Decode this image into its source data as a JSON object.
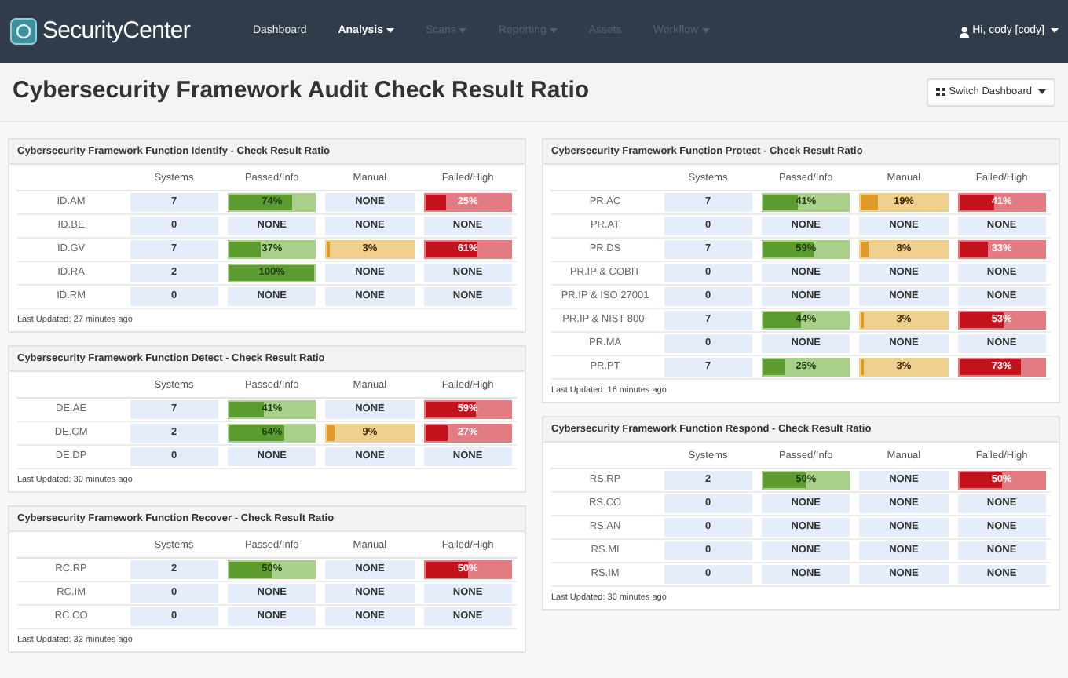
{
  "navbar": {
    "brand": "SecurityCenter",
    "items": [
      {
        "label": "Dashboard",
        "caret": false,
        "selected": false,
        "disabled": false
      },
      {
        "label": "Analysis",
        "caret": true,
        "selected": true,
        "disabled": false
      },
      {
        "label": "Scans",
        "caret": true,
        "selected": false,
        "disabled": true
      },
      {
        "label": "Reporting",
        "caret": true,
        "selected": false,
        "disabled": true
      },
      {
        "label": "Assets",
        "caret": false,
        "selected": false,
        "disabled": true
      },
      {
        "label": "Workflow",
        "caret": true,
        "selected": false,
        "disabled": true
      }
    ],
    "user": "Hi, cody [cody]"
  },
  "page_title": "Cybersecurity Framework Audit Check Result Ratio",
  "switch_button": "Switch Dashboard",
  "columns": [
    [
      {
        "title": "Cybersecurity Framework Function Identify - Check Result Ratio",
        "headers": [
          "Systems",
          "Passed/Info",
          "Manual",
          "Failed/High"
        ],
        "rows": [
          {
            "label": "ID.AM",
            "systems": "7",
            "passed": {
              "text": "74%",
              "level": 0.74
            },
            "manual": {
              "text": "NONE"
            },
            "failed": {
              "text": "25%",
              "level": 0.25
            }
          },
          {
            "label": "ID.BE",
            "systems": "0",
            "passed": {
              "text": "NONE"
            },
            "manual": {
              "text": "NONE"
            },
            "failed": {
              "text": "NONE"
            }
          },
          {
            "label": "ID.GV",
            "systems": "7",
            "passed": {
              "text": "37%",
              "level": 0.37
            },
            "manual": {
              "text": "3%",
              "level": 0.03
            },
            "failed": {
              "text": "61%",
              "level": 0.61
            }
          },
          {
            "label": "ID.RA",
            "systems": "2",
            "passed": {
              "text": "100%",
              "level": 1
            },
            "manual": {
              "text": "NONE"
            },
            "failed": {
              "text": "NONE"
            }
          },
          {
            "label": "ID.RM",
            "systems": "0",
            "passed": {
              "text": "NONE"
            },
            "manual": {
              "text": "NONE"
            },
            "failed": {
              "text": "NONE"
            }
          }
        ],
        "footer": "Last Updated: 27 minutes ago"
      },
      {
        "title": "Cybersecurity Framework Function Detect - Check Result Ratio",
        "headers": [
          "Systems",
          "Passed/Info",
          "Manual",
          "Failed/High"
        ],
        "rows": [
          {
            "label": "DE.AE",
            "systems": "7",
            "passed": {
              "text": "41%",
              "level": 0.41
            },
            "manual": {
              "text": "NONE"
            },
            "failed": {
              "text": "59%",
              "level": 0.59
            }
          },
          {
            "label": "DE.CM",
            "systems": "2",
            "passed": {
              "text": "64%",
              "level": 0.64
            },
            "manual": {
              "text": "9%",
              "level": 0.09
            },
            "failed": {
              "text": "27%",
              "level": 0.27
            }
          },
          {
            "label": "DE.DP",
            "systems": "0",
            "passed": {
              "text": "NONE"
            },
            "manual": {
              "text": "NONE"
            },
            "failed": {
              "text": "NONE"
            }
          }
        ],
        "footer": "Last Updated: 30 minutes ago"
      },
      {
        "title": "Cybersecurity Framework Function Recover - Check Result Ratio",
        "headers": [
          "Systems",
          "Passed/Info",
          "Manual",
          "Failed/High"
        ],
        "rows": [
          {
            "label": "RC.RP",
            "systems": "2",
            "passed": {
              "text": "50%",
              "level": 0.5
            },
            "manual": {
              "text": "NONE"
            },
            "failed": {
              "text": "50%",
              "level": 0.5
            }
          },
          {
            "label": "RC.IM",
            "systems": "0",
            "passed": {
              "text": "NONE"
            },
            "manual": {
              "text": "NONE"
            },
            "failed": {
              "text": "NONE"
            }
          },
          {
            "label": "RC.CO",
            "systems": "0",
            "passed": {
              "text": "NONE"
            },
            "manual": {
              "text": "NONE"
            },
            "failed": {
              "text": "NONE"
            }
          }
        ],
        "footer": "Last Updated: 33 minutes ago"
      }
    ],
    [
      {
        "title": "Cybersecurity Framework Function Protect - Check Result Ratio",
        "headers": [
          "Systems",
          "Passed/Info",
          "Manual",
          "Failed/High"
        ],
        "rows": [
          {
            "label": "PR.AC",
            "systems": "7",
            "passed": {
              "text": "41%",
              "level": 0.41
            },
            "manual": {
              "text": "19%",
              "level": 0.19
            },
            "failed": {
              "text": "41%",
              "level": 0.41
            }
          },
          {
            "label": "PR.AT",
            "systems": "0",
            "passed": {
              "text": "NONE"
            },
            "manual": {
              "text": "NONE"
            },
            "failed": {
              "text": "NONE"
            }
          },
          {
            "label": "PR.DS",
            "systems": "7",
            "passed": {
              "text": "59%",
              "level": 0.59
            },
            "manual": {
              "text": "8%",
              "level": 0.08
            },
            "failed": {
              "text": "33%",
              "level": 0.33
            }
          },
          {
            "label": "PR.IP & COBIT",
            "systems": "0",
            "passed": {
              "text": "NONE"
            },
            "manual": {
              "text": "NONE"
            },
            "failed": {
              "text": "NONE"
            }
          },
          {
            "label": "PR.IP & ISO 27001",
            "systems": "0",
            "passed": {
              "text": "NONE"
            },
            "manual": {
              "text": "NONE"
            },
            "failed": {
              "text": "NONE"
            }
          },
          {
            "label": "PR.IP & NIST 800-",
            "systems": "7",
            "passed": {
              "text": "44%",
              "level": 0.44
            },
            "manual": {
              "text": "3%",
              "level": 0.03
            },
            "failed": {
              "text": "53%",
              "level": 0.53
            }
          },
          {
            "label": "PR.MA",
            "systems": "0",
            "passed": {
              "text": "NONE"
            },
            "manual": {
              "text": "NONE"
            },
            "failed": {
              "text": "NONE"
            }
          },
          {
            "label": "PR.PT",
            "systems": "7",
            "passed": {
              "text": "25%",
              "level": 0.25
            },
            "manual": {
              "text": "3%",
              "level": 0.03
            },
            "failed": {
              "text": "73%",
              "level": 0.73
            }
          }
        ],
        "footer": "Last Updated: 16 minutes ago"
      },
      {
        "title": "Cybersecurity Framework Function Respond - Check Result Ratio",
        "headers": [
          "Systems",
          "Passed/Info",
          "Manual",
          "Failed/High"
        ],
        "rows": [
          {
            "label": "RS.RP",
            "systems": "2",
            "passed": {
              "text": "50%",
              "level": 0.5
            },
            "manual": {
              "text": "NONE"
            },
            "failed": {
              "text": "50%",
              "level": 0.5
            }
          },
          {
            "label": "RS.CO",
            "systems": "0",
            "passed": {
              "text": "NONE"
            },
            "manual": {
              "text": "NONE"
            },
            "failed": {
              "text": "NONE"
            }
          },
          {
            "label": "RS.AN",
            "systems": "0",
            "passed": {
              "text": "NONE"
            },
            "manual": {
              "text": "NONE"
            },
            "failed": {
              "text": "NONE"
            }
          },
          {
            "label": "RS.MI",
            "systems": "0",
            "passed": {
              "text": "NONE"
            },
            "manual": {
              "text": "NONE"
            },
            "failed": {
              "text": "NONE"
            }
          },
          {
            "label": "RS.IM",
            "systems": "0",
            "passed": {
              "text": "NONE"
            },
            "manual": {
              "text": "NONE"
            },
            "failed": {
              "text": "NONE"
            }
          }
        ],
        "footer": "Last Updated: 30 minutes ago"
      }
    ]
  ]
}
